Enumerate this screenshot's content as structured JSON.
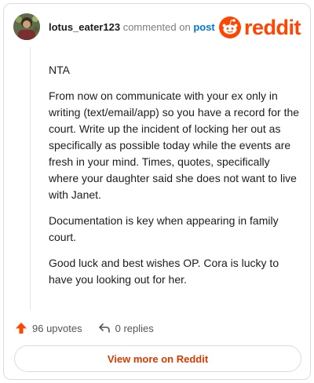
{
  "header": {
    "username": "lotus_eater123",
    "commented_on": "commented on",
    "post_link": "post",
    "logo_text": "reddit",
    "logo_icon": "reddit-snoo-icon",
    "brand_color": "#ff4500"
  },
  "comment": {
    "paragraphs": [
      "NTA",
      "From now on communicate with your ex only in writing (text/email/app) so you have a record for the court. Write up the incident of locking her out as specifically as possible today while the events are fresh in your mind. Times, quotes, specifically where your daughter said she does not want to live with Janet.",
      "Documentation is key when appearing in family court.",
      "Good luck and best wishes OP. Cora is lucky to have you looking out for her."
    ]
  },
  "actions": {
    "upvotes": "96 upvotes",
    "upvote_icon": "upvote-arrow-icon",
    "replies": "0 replies",
    "reply_icon": "reply-arrow-icon"
  },
  "footer": {
    "view_more": "View more on Reddit"
  }
}
